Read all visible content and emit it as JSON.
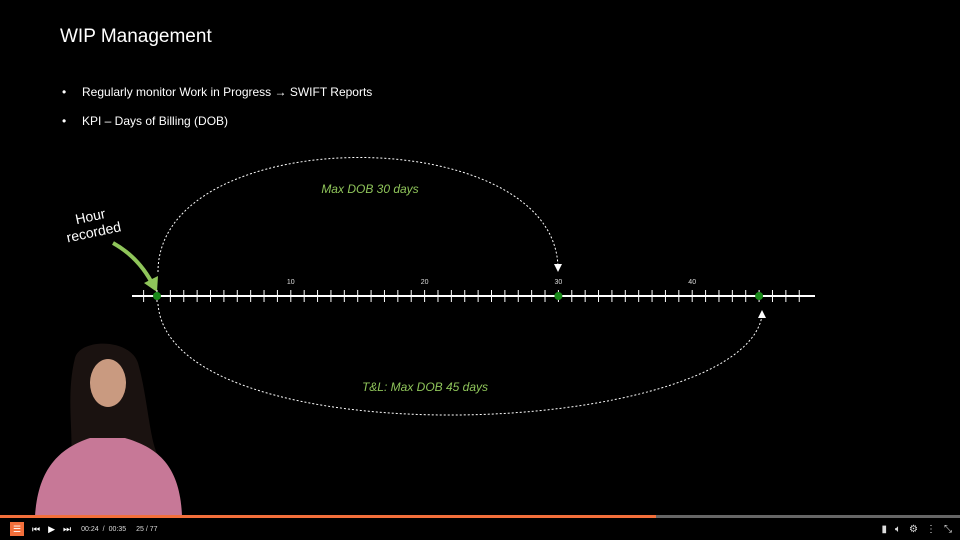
{
  "slide": {
    "title": "WIP Management",
    "bullets": [
      "Regularly monitor Work in Progress → SWIFT Reports",
      "KPI – Days of Billing (DOB)"
    ],
    "hour_label": "Hour recorded",
    "top_arc_label": "Max DOB 30 days",
    "bottom_arc_label": "T&L: Max DOB 45 days",
    "tick_labels": [
      "10",
      "20",
      "30",
      "40"
    ],
    "markers": [
      0,
      30,
      45
    ],
    "accent": "#8fc55a",
    "marker_color": "#1a8a1a"
  },
  "player": {
    "current_time": "00:24",
    "separator": "/",
    "total_time": "00:35",
    "slide_count": "25 / 77",
    "progress_percent": 68.3,
    "accent": "#f36f3b",
    "icons": [
      "menu-icon",
      "skip-back-icon",
      "play-icon",
      "skip-forward-icon",
      "notes-icon",
      "volume-icon",
      "settings-icon",
      "more-icon",
      "fullscreen-exit-icon"
    ]
  }
}
